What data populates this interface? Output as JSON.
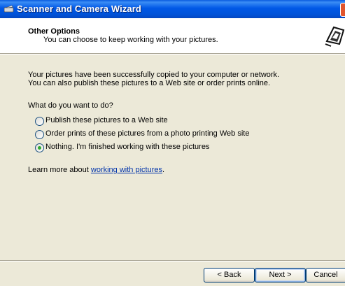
{
  "window": {
    "title": "Scanner and Camera Wizard"
  },
  "header": {
    "title": "Other Options",
    "subtitle": "You can choose to keep working with your pictures."
  },
  "body": {
    "intro_line1": "Your pictures have been successfully copied to your computer or network.",
    "intro_line2": "You can also publish these pictures to a Web site or order prints online.",
    "question": "What do you want to do?",
    "options": [
      {
        "label": "Publish these pictures to a Web site",
        "selected": false
      },
      {
        "label": "Order prints of these pictures from a photo printing Web site",
        "selected": false
      },
      {
        "label": "Nothing. I'm finished working with these pictures",
        "selected": true
      }
    ],
    "learn_more_prefix": "Learn more about ",
    "learn_more_link": "working with pictures",
    "learn_more_suffix": "."
  },
  "buttons": {
    "back": "< Back",
    "next": "Next >",
    "cancel": "Cancel"
  },
  "colors": {
    "titlebar": "#0058e6",
    "link": "#0033aa",
    "radio_selected": "#2fa82f"
  }
}
